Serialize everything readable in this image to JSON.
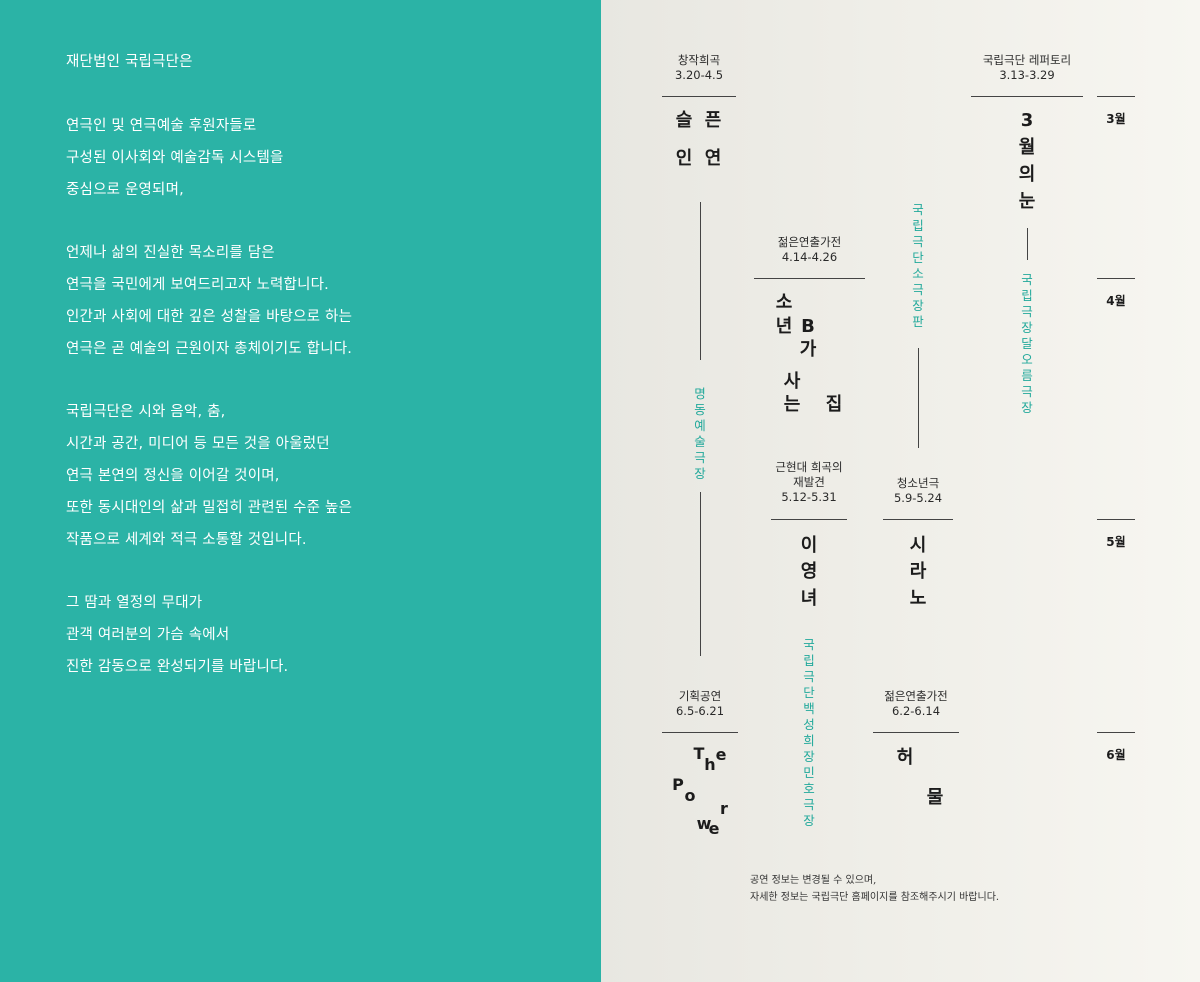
{
  "intro": {
    "lines": [
      "재단법인 국립극단은",
      "연극인 및 연극예술 후원자들로",
      "구성된 이사회와 예술감독 시스템을",
      "중심으로 운영되며,",
      "언제나 삶의 진실한 목소리를 담은",
      "연극을 국민에게 보여드리고자 노력합니다.",
      "인간과 사회에 대한 깊은 성찰을 바탕으로 하는",
      "연극은 곧 예술의 근원이자 총체이기도 합니다.",
      "국립극단은 시와 음악, 춤,",
      "시간과 공간, 미디어 등 모든 것을 아울렀던",
      "연극 본연의 정신을 이어갈 것이며,",
      "또한 동시대인의 삶과 밀접히 관련된 수준 높은",
      "작품으로 세계와 적극 소통할 것입니다.",
      "그 땀과 열정의 무대가",
      "관객 여러분의 가슴 속에서",
      "진한 감동으로 완성되기를 바랍니다."
    ]
  },
  "months": [
    "3월",
    "4월",
    "5월",
    "6월"
  ],
  "venues": {
    "myeongdong": "명동예술극장",
    "sogukjang": "국립극단 소극장 판",
    "dareoreum": "국립극장 달오름극장",
    "baekseonghui": "국립극단 백성희장민호극장"
  },
  "shows": {
    "seulpeun": {
      "category": "창작희곡",
      "dates": "3.20-4.5",
      "title_chars": [
        "슬",
        "픈",
        "인",
        "연"
      ]
    },
    "march_eyes": {
      "category": "국립극단 레퍼토리",
      "dates": "3.13-3.29",
      "title_chars": [
        "3",
        "월",
        "의",
        "눈"
      ]
    },
    "boy_b": {
      "category": "젊은연출가전",
      "dates": "4.14-4.26",
      "title_chars": [
        "소",
        "년",
        "B",
        "가",
        "사",
        "는",
        "집"
      ]
    },
    "lee_youngnyeo": {
      "category_line1": "근현대 희곡의",
      "category_line2": "재발견",
      "dates": "5.12-5.31",
      "title_chars": [
        "이",
        "영",
        "녀"
      ]
    },
    "cyrano": {
      "category": "청소년극",
      "dates": "5.9-5.24",
      "title_chars": [
        "시",
        "라",
        "노"
      ]
    },
    "the_power": {
      "category": "기획공연",
      "dates": "6.5-6.21",
      "title_chars": [
        "T",
        "h",
        "e",
        "P",
        "o",
        "w",
        "e",
        "r"
      ]
    },
    "heomul": {
      "category": "젊은연출가전",
      "dates": "6.2-6.14",
      "title_chars": [
        "허",
        "물"
      ]
    }
  },
  "footnote": {
    "line1": "공연 정보는 변경될 수 있으며,",
    "line2": "자세한 정보는 국립극단 홈페이지를 참조해주시기 바랍니다."
  },
  "colors": {
    "left_panel": "#2bb3a6",
    "venue_text": "#22a99b"
  }
}
